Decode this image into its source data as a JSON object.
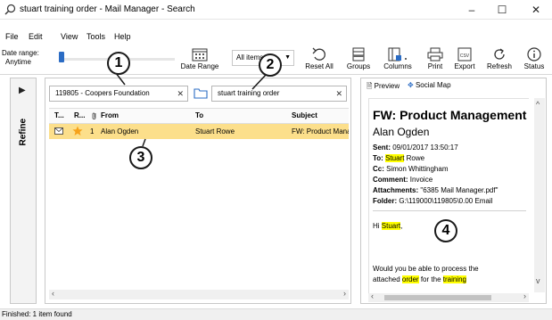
{
  "window": {
    "title": "stuart training order - Mail Manager - Search",
    "minimize": "–",
    "maximize": "☐",
    "close": "✕"
  },
  "menu": {
    "items": [
      "File",
      "Edit",
      "View",
      "Tools",
      "Help"
    ]
  },
  "ribbon": {
    "date_range_label": "Date range:",
    "date_range_value": "Anytime",
    "date_range_button": "Date Range",
    "items_filter": "All items",
    "reset_all": "Reset All",
    "groups": "Groups",
    "columns": "Columns",
    "print": "Print",
    "export": "Export",
    "refresh": "Refresh",
    "status": "Status",
    "accent_color": "#2b6cc4"
  },
  "refine": {
    "label": "Refine",
    "arrow": "▶"
  },
  "filters": {
    "folder": "119805 - Coopers Foundation",
    "search": "stuart training order",
    "clear": "✕"
  },
  "grid": {
    "columns": [
      "T...",
      "R...",
      "",
      "From",
      "To",
      "Subject"
    ],
    "rows": [
      {
        "rank": "1",
        "from": "Alan Ogden",
        "to": "Stuart Rowe",
        "subject": "FW: Product Manage"
      }
    ],
    "selected_color": "#fcdf8b"
  },
  "preview": {
    "tab_preview": "Preview",
    "tab_social": "Social Map",
    "subject": "FW: Product Management",
    "sender": "Alan Ogden",
    "sent_label": "Sent:",
    "sent_value": "09/01/2017 13:50:17",
    "to_label": "To:",
    "to_highlight": "Stuart",
    "to_rest": " Rowe",
    "cc_label": "Cc:",
    "cc_value": "Simon Whittingham",
    "comment_label": "Comment:",
    "comment_value": "Invoice",
    "attachments_label": "Attachments:",
    "attachments_value": "\"6385 Mail Manager.pdf\"",
    "folder_label": "Folder:",
    "folder_value": "G:\\119000\\119805\\0.00 Email",
    "greeting_pre": "Hi ",
    "greeting_name": "Stuart",
    "greeting_post": ",",
    "body_line1": "Would you be able to process the",
    "body_line2_pre": "attached ",
    "body_line2_hl1": "order",
    "body_line2_mid": " for the ",
    "body_line2_hl2": "training",
    "highlight_color": "#ffff00"
  },
  "status": {
    "text": "Finished: 1 item found"
  },
  "callouts": [
    "1",
    "2",
    "3",
    "4"
  ]
}
